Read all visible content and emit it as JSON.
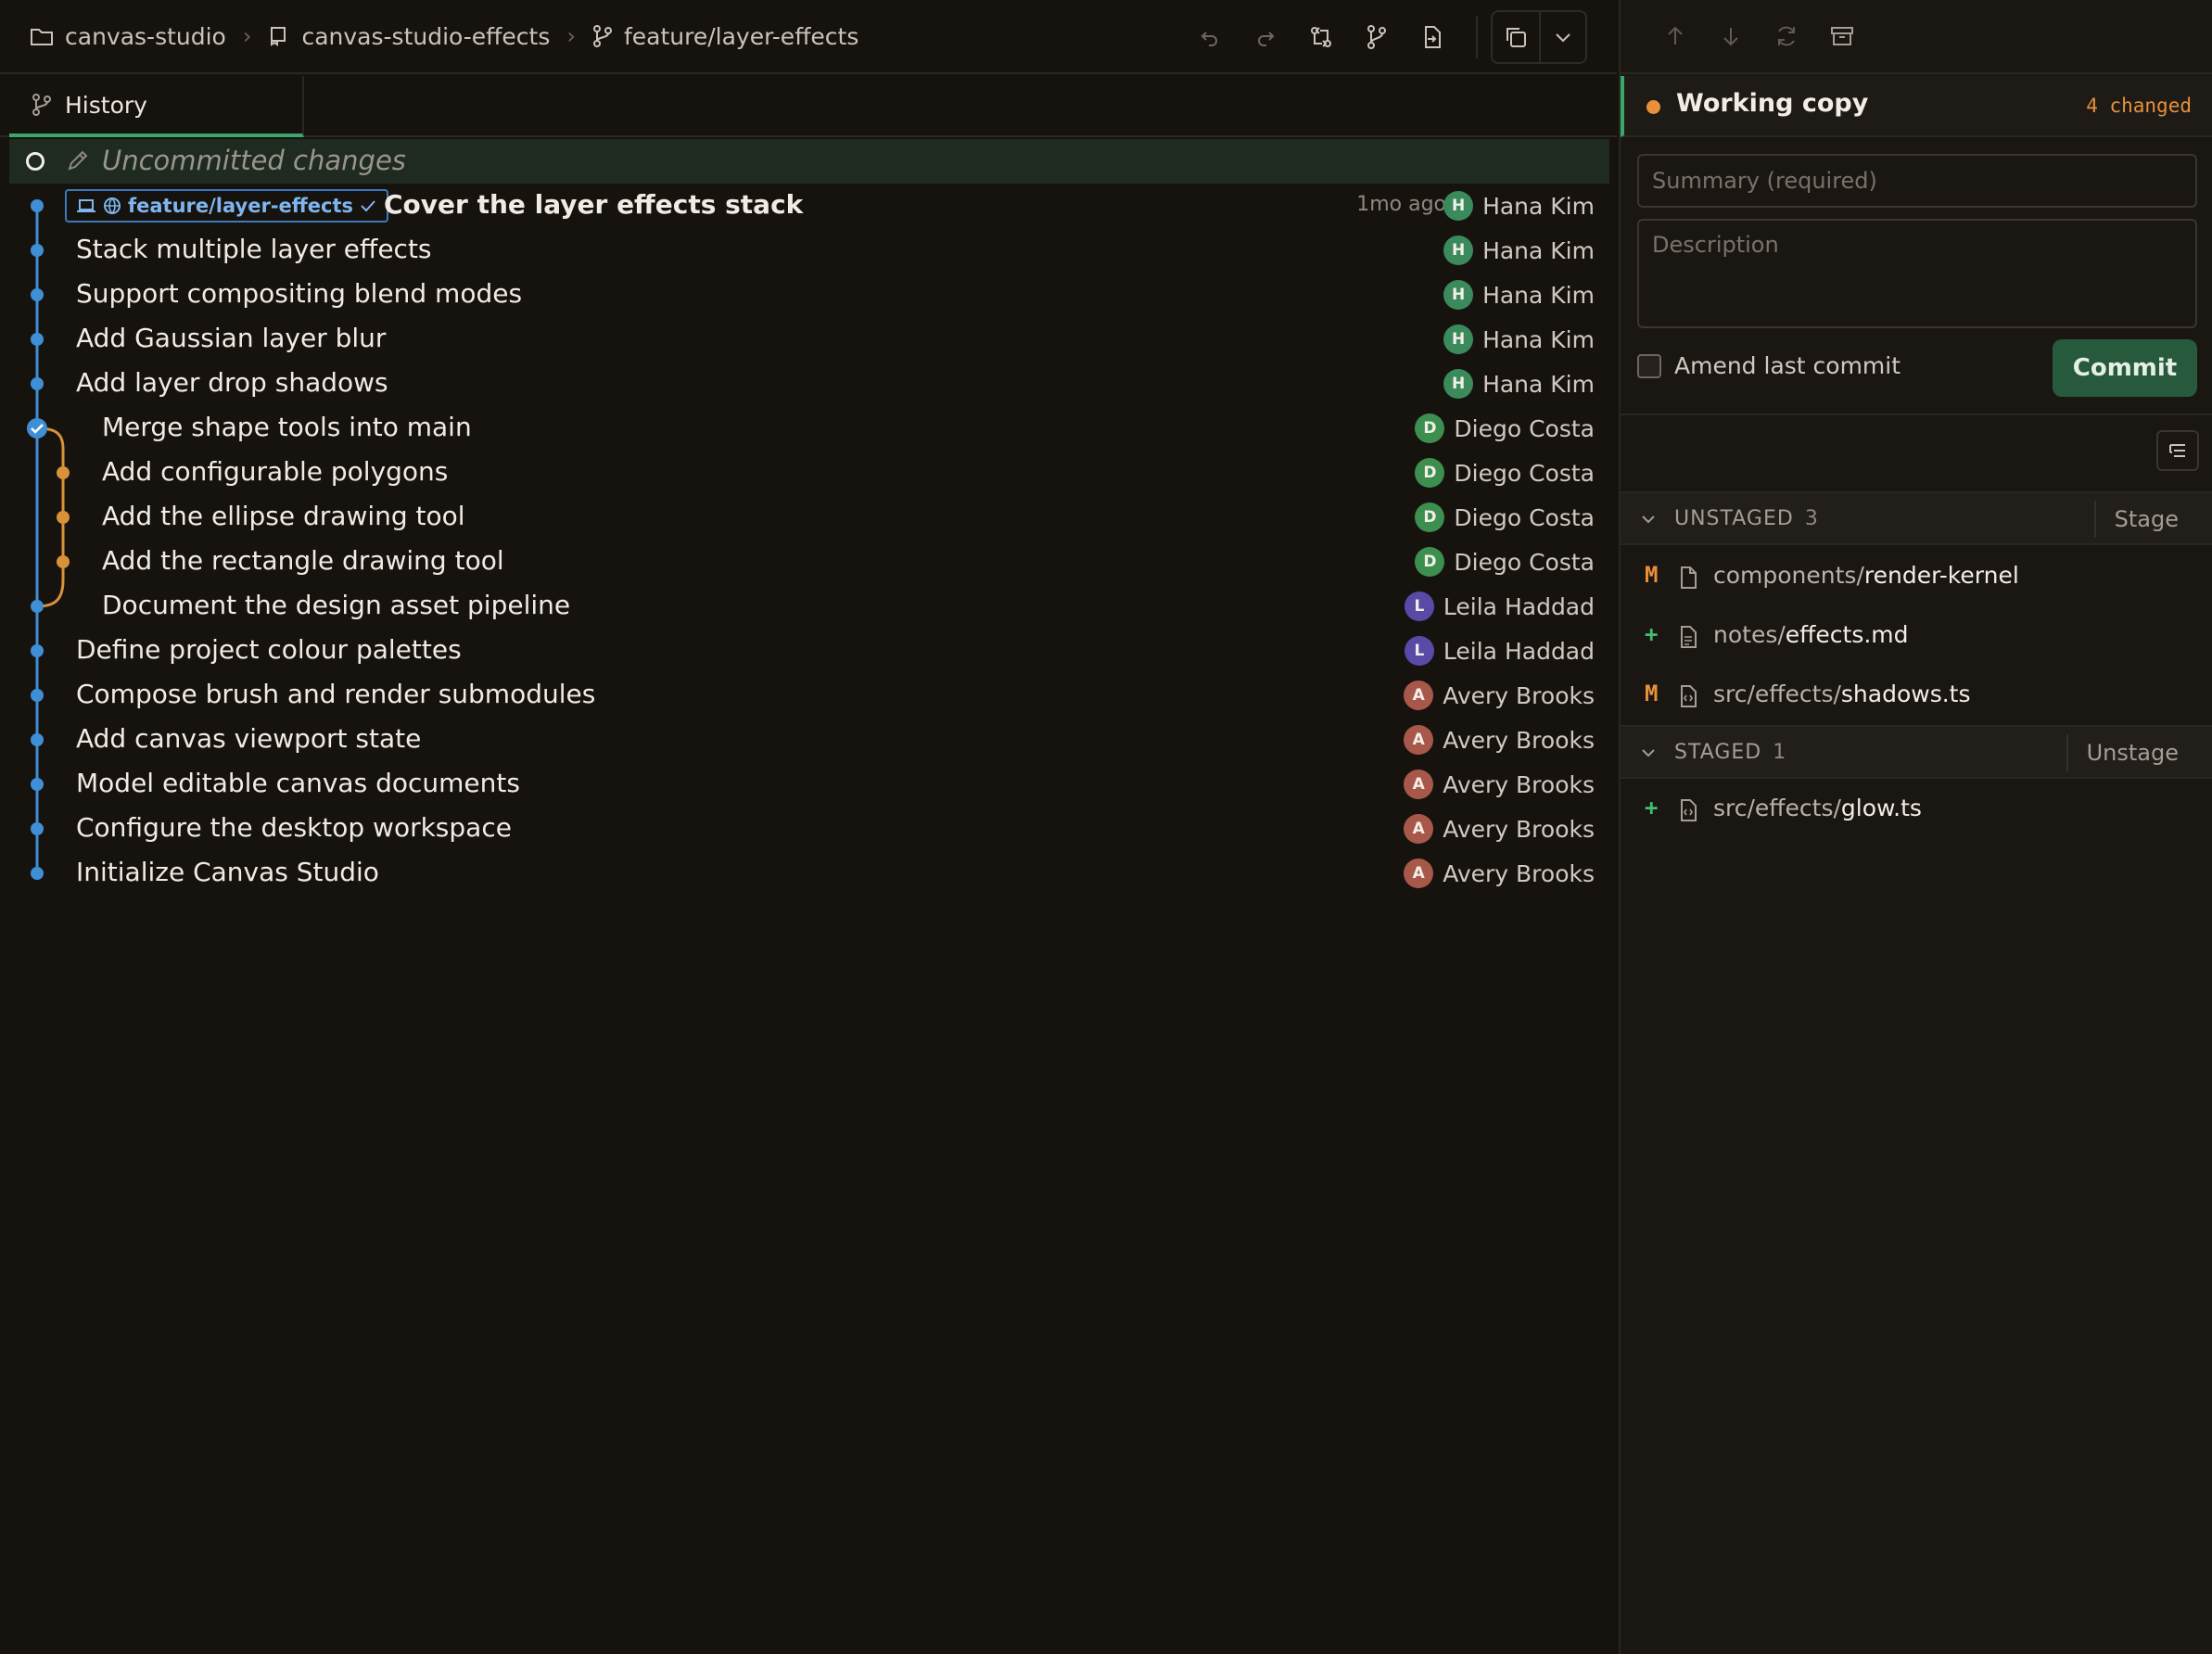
{
  "breadcrumb": {
    "repo": "canvas-studio",
    "worktree": "canvas-studio-effects",
    "branch": "feature/layer-effects"
  },
  "toolbar": {
    "icons": [
      "undo-icon",
      "redo-icon",
      "compare-icon",
      "branch-icon",
      "file-export-icon",
      "copy-icon",
      "chevron-down-icon"
    ]
  },
  "tabs": [
    {
      "label": "History",
      "active": true
    }
  ],
  "history": {
    "uncommitted_label": "Uncommitted changes",
    "head": {
      "branch_tag": "feature/layer-effects",
      "message": "Cover the layer effects stack",
      "time": "1mo ago",
      "author": "Hana Kim",
      "avatar": "H"
    },
    "commits": [
      {
        "message": "Stack multiple layer effects",
        "author": "Hana Kim",
        "avatar": "H"
      },
      {
        "message": "Support compositing blend modes",
        "author": "Hana Kim",
        "avatar": "H"
      },
      {
        "message": "Add Gaussian layer blur",
        "author": "Hana Kim",
        "avatar": "H"
      },
      {
        "message": "Add layer drop shadows",
        "author": "Hana Kim",
        "avatar": "H"
      },
      {
        "message": "Merge shape tools into main",
        "author": "Diego Costa",
        "avatar": "D"
      },
      {
        "message": "Add configurable polygons",
        "author": "Diego Costa",
        "avatar": "D"
      },
      {
        "message": "Add the ellipse drawing tool",
        "author": "Diego Costa",
        "avatar": "D"
      },
      {
        "message": "Add the rectangle drawing tool",
        "author": "Diego Costa",
        "avatar": "D"
      },
      {
        "message": "Document the design asset pipeline",
        "author": "Leila Haddad",
        "avatar": "L"
      },
      {
        "message": "Define project colour palettes",
        "author": "Leila Haddad",
        "avatar": "L"
      },
      {
        "message": "Compose brush and render submodules",
        "author": "Avery Brooks",
        "avatar": "A"
      },
      {
        "message": "Add canvas viewport state",
        "author": "Avery Brooks",
        "avatar": "A"
      },
      {
        "message": "Model editable canvas documents",
        "author": "Avery Brooks",
        "avatar": "A"
      },
      {
        "message": "Configure the desktop workspace",
        "author": "Avery Brooks",
        "avatar": "A"
      },
      {
        "message": "Initialize Canvas Studio",
        "author": "Avery Brooks",
        "avatar": "A"
      }
    ]
  },
  "avatar_colors": {
    "H": "#3a8a5c",
    "D": "#3d8f4f",
    "L": "#5a4aa8",
    "A": "#a8584a"
  },
  "graph_colors": {
    "main": "#3f8fd6",
    "side": "#d9913a"
  },
  "working_copy": {
    "title": "Working copy",
    "changed": "4 changed",
    "summary_placeholder": "Summary (required)",
    "description_placeholder": "Description",
    "amend_label": "Amend last commit",
    "commit_label": "Commit"
  },
  "unstaged": {
    "label": "UNSTAGED",
    "count": "3",
    "action": "Stage",
    "files": [
      {
        "status": "M",
        "dir": "components/",
        "name": "render-kernel",
        "icon": "file-icon"
      },
      {
        "status": "+",
        "dir": "notes/",
        "name": "effects.md",
        "icon": "file-text-icon"
      },
      {
        "status": "M",
        "dir": "src/effects/",
        "name": "shadows.ts",
        "icon": "file-code-icon"
      }
    ]
  },
  "staged": {
    "label": "STAGED",
    "count": "1",
    "action": "Unstage",
    "files": [
      {
        "status": "+",
        "dir": "src/effects/",
        "name": "glow.ts",
        "icon": "file-code-icon"
      }
    ]
  },
  "status_colors": {
    "M": "#e8903a",
    "+": "#3fbf6f"
  }
}
